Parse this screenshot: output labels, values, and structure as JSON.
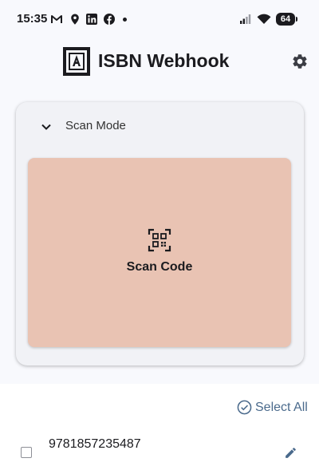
{
  "status_bar": {
    "time": "15:35",
    "notification_icons": [
      "gmail-icon",
      "location-pin-icon",
      "linkedin-icon",
      "facebook-icon",
      "dot-icon"
    ],
    "system_icons": [
      "signal-icon",
      "wifi-icon",
      "battery-icon"
    ],
    "battery_level": "64"
  },
  "header": {
    "logo_icon": "app-logo-icon",
    "title": "ISBN Webhook",
    "settings_icon": "gear-icon"
  },
  "scan_panel": {
    "mode_label": "Scan Mode",
    "mode_toggle_icon": "chevron-down-icon",
    "scan_icon": "qr-code-scan-icon",
    "scan_label": "Scan Code",
    "scan_area_color": "#e9c3b3"
  },
  "list": {
    "select_all_label": "Select All",
    "select_all_icon": "check-circle-icon",
    "items": [
      {
        "isbn": "9781857235487",
        "checked": false,
        "edit_icon": "pencil-icon"
      }
    ]
  },
  "colors": {
    "accent": "#4a6a8c",
    "background": "#f8f9fd",
    "card": "#f1f2f6"
  }
}
